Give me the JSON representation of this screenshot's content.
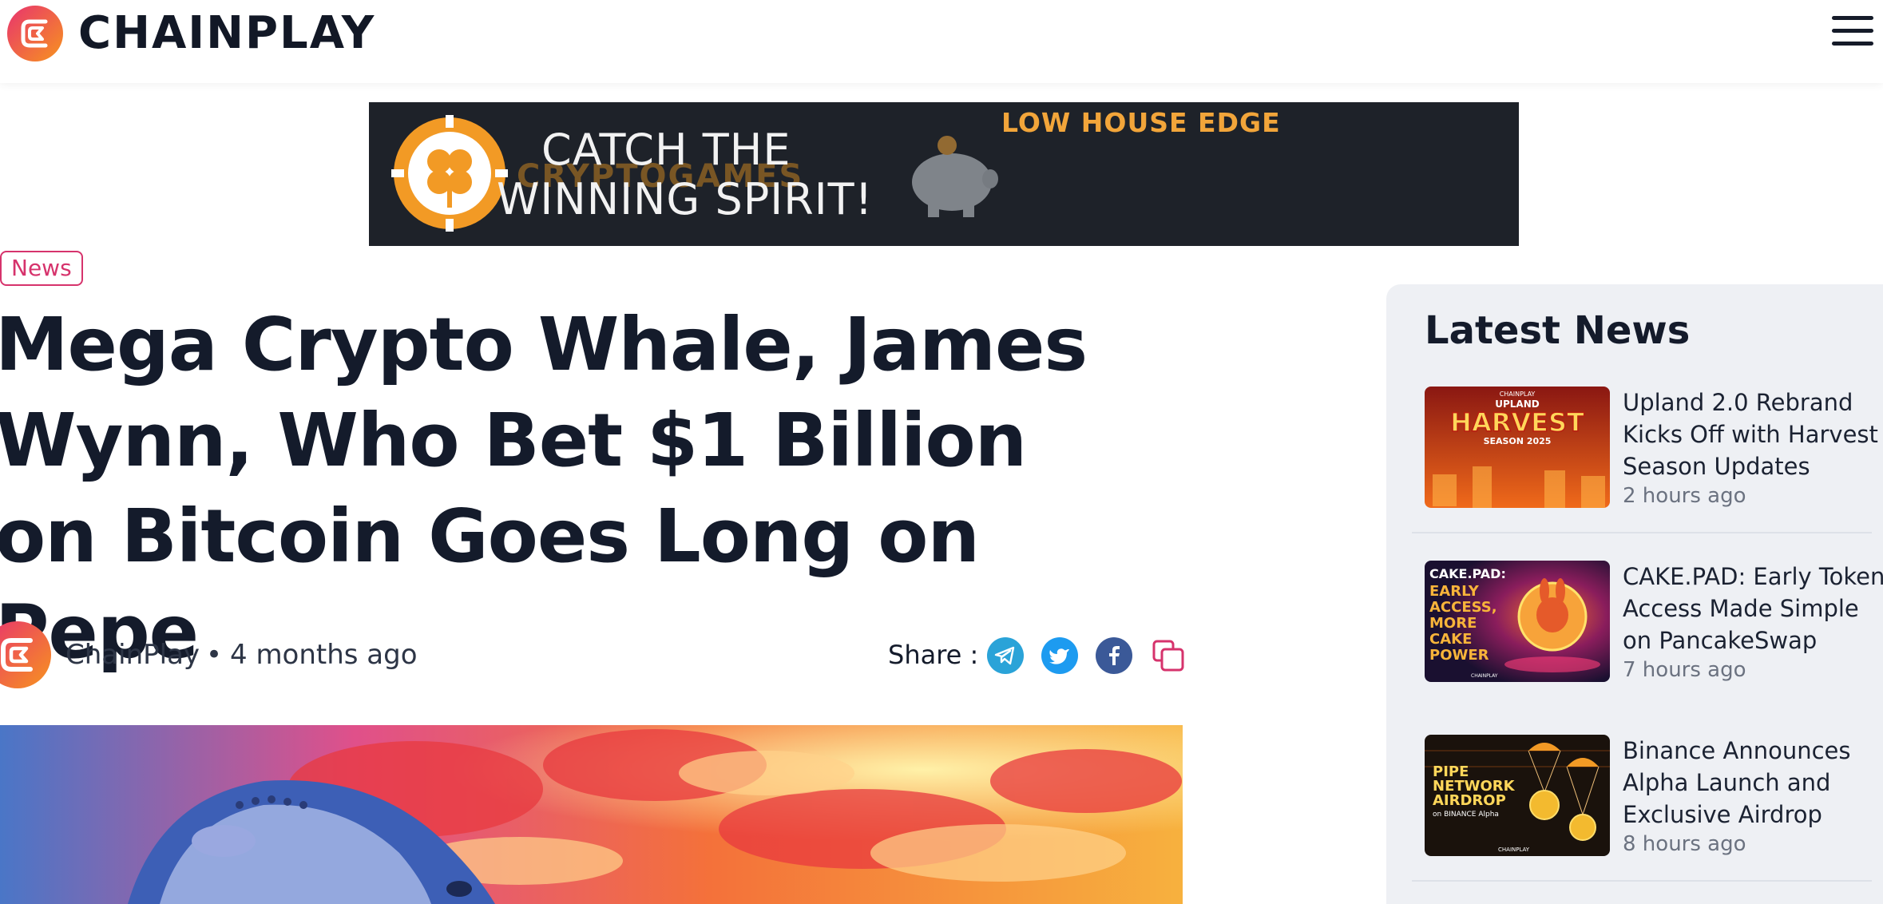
{
  "header": {
    "brand": "CHAINPLAY",
    "menu_icon": "hamburger-menu-icon"
  },
  "banner": {
    "line1": "CATCH THE",
    "line2": "WINNING SPIRIT!",
    "ghost_brand": "CRYPTOGAMES",
    "tagline": "LOW HOUSE EDGE",
    "colors": {
      "background": "#1e2229",
      "accent": "#f2a53a"
    }
  },
  "article": {
    "category": "News",
    "title": "Mega Crypto Whale, James Wynn, Who Bet $1 Billion on Bitcoin Goes Long on Pepe",
    "author": "ChainPlay",
    "separator": "•",
    "published": "4 months ago",
    "share_label": "Share :",
    "share_buttons": [
      {
        "icon": "telegram-icon",
        "color": "#2aa3d8"
      },
      {
        "icon": "twitter-icon",
        "color": "#1d9bf0"
      },
      {
        "icon": "facebook-icon",
        "color": "#3b5998"
      },
      {
        "icon": "copy-link-icon",
        "color": "#d6336c"
      }
    ]
  },
  "sidebar": {
    "title": "Latest News",
    "items": [
      {
        "title": "Upland 2.0 Rebrand Kicks Off with Harvest Season Updates",
        "time": "2 hours ago",
        "thumb_text": {
          "brand": "CHAINPLAY",
          "top": "UPLAND",
          "main": "HARVEST",
          "sub": "SEASON 2025"
        }
      },
      {
        "title": "CAKE.PAD: Early Token Access Made Simple on PancakeSwap",
        "time": "7 hours ago",
        "thumb_text": {
          "head": "CAKE.PAD:",
          "lines": [
            "EARLY",
            "ACCESS,",
            "MORE",
            "CAKE",
            "POWER"
          ],
          "brand": "CHAINPLAY"
        }
      },
      {
        "title": "Binance Announces Alpha Launch and Exclusive Airdrop",
        "time": "8 hours ago",
        "thumb_text": {
          "lines": [
            "PIPE",
            "NETWORK",
            "AIRDROP"
          ],
          "sub": "on BINANCE Alpha",
          "brand": "CHAINPLAY"
        }
      }
    ]
  }
}
